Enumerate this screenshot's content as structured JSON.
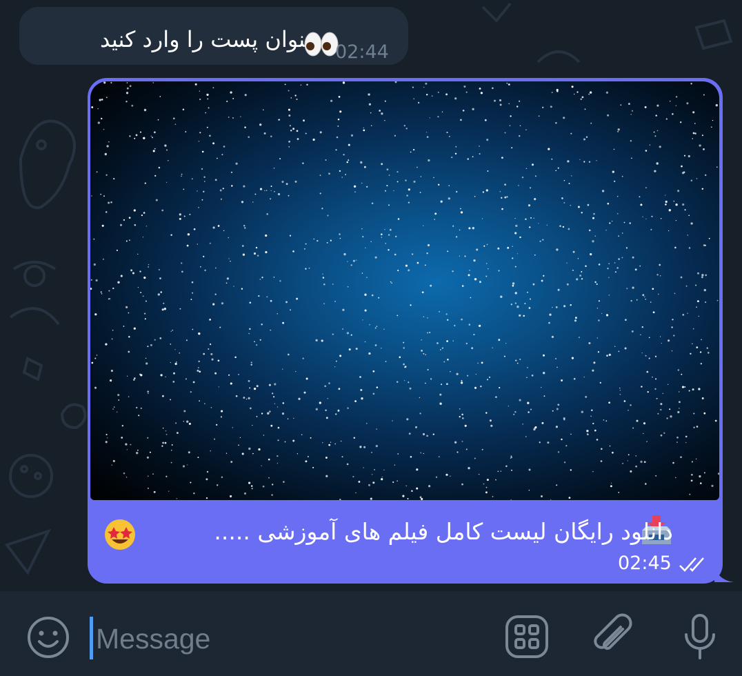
{
  "chat": {
    "incoming": {
      "text": "عنوان پست را وارد کنید",
      "emoji": "eyes",
      "time": "02:44"
    },
    "outgoing": {
      "image": "starfield-photo",
      "caption": "دانلود رایگان لیست کامل فیلم های آموزشی .....",
      "caption_emoji_start": "inbox-tray",
      "caption_emoji_end": "star-struck",
      "time": "02:45",
      "status": "read",
      "bubble_color": "#6a6ef3"
    }
  },
  "composer": {
    "placeholder": "Message",
    "icons": [
      "smile-icon",
      "grid-icon",
      "paperclip-icon",
      "microphone-icon"
    ]
  },
  "colors": {
    "background": "#17212b",
    "incoming_bubble": "#222e3b",
    "accent": "#4f9cf0"
  }
}
